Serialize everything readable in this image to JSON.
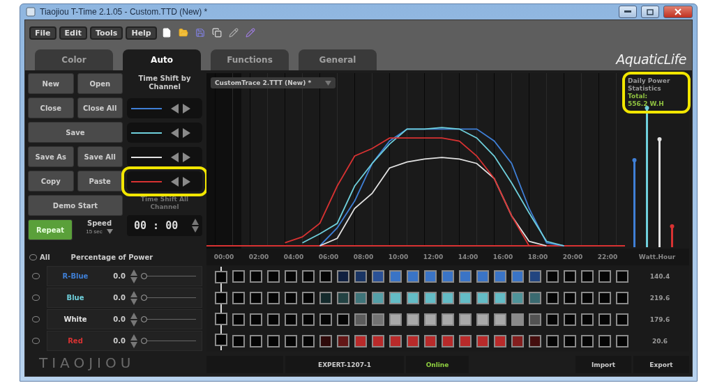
{
  "window": {
    "title": "Tiaojiou T-Time 2.1.05 - Custom.TTD (New) *"
  },
  "menu": [
    "File",
    "Edit",
    "Tools",
    "Help"
  ],
  "tabs": [
    {
      "label": "Color",
      "selected": false
    },
    {
      "label": "Auto",
      "selected": true
    },
    {
      "label": "Functions",
      "selected": false
    },
    {
      "label": "General",
      "selected": false
    }
  ],
  "logo": {
    "text": "AquaticLife"
  },
  "file_buttons": [
    [
      "New",
      "Open"
    ],
    [
      "Close",
      "Close All"
    ],
    [
      "Save"
    ],
    [
      "Save As",
      "Save All"
    ],
    [
      "Copy",
      "Paste"
    ],
    [
      "Demo Start"
    ]
  ],
  "repeat": {
    "label": "Repeat",
    "on": true
  },
  "speed": {
    "label": "Speed",
    "value": "15 sec"
  },
  "time_shift": {
    "title": "Time Shift by Channel",
    "rows": [
      {
        "highlighted": false
      },
      {
        "highlighted": false
      },
      {
        "highlighted": false
      },
      {
        "highlighted": true
      }
    ],
    "all_label": "Time Shift All Channel",
    "all_disabled": true,
    "time": "00 : 00"
  },
  "power": {
    "all_label": "All",
    "all_selected": false,
    "title": "Percentage of Power"
  },
  "channels": [
    {
      "name": "R-Blue",
      "color": "#3f7fd6",
      "selected": false,
      "percent": "0.0",
      "level": 0,
      "watt_hours": "140.4",
      "cells": [
        {
          "color": "#050505"
        },
        {
          "color": "#050505"
        },
        {
          "color": "#050505"
        },
        {
          "color": "#050505"
        },
        {
          "color": "#050505"
        },
        {
          "color": "#050505"
        },
        {
          "color": "#050505"
        },
        {
          "color": "#102040"
        },
        {
          "color": "#1a3564"
        },
        {
          "color": "#2a5196"
        },
        {
          "color": "#3a74c6"
        },
        {
          "color": "#3a74c6"
        },
        {
          "color": "#3a74c6"
        },
        {
          "color": "#3a74c6"
        },
        {
          "color": "#3a74c6"
        },
        {
          "color": "#3a74c6"
        },
        {
          "color": "#3a74c6"
        },
        {
          "color": "#3a74c6"
        },
        {
          "color": "#224580"
        },
        {
          "color": "#050505"
        },
        {
          "color": "#050505"
        },
        {
          "color": "#050505"
        },
        {
          "color": "#050505"
        },
        {
          "color": "#050505"
        }
      ]
    },
    {
      "name": "Blue",
      "color": "#6fd0dc",
      "selected": false,
      "percent": "0.0",
      "level": 0,
      "watt_hours": "219.6",
      "cells": [
        {
          "color": "#050505"
        },
        {
          "color": "#050505"
        },
        {
          "color": "#050505"
        },
        {
          "color": "#050505"
        },
        {
          "color": "#050505"
        },
        {
          "color": "#050505"
        },
        {
          "color": "#142a2c"
        },
        {
          "color": "#234243"
        },
        {
          "color": "#3f7479"
        },
        {
          "color": "#55a0a8"
        },
        {
          "color": "#64bcc6"
        },
        {
          "color": "#64bcc6"
        },
        {
          "color": "#64bcc6"
        },
        {
          "color": "#64bcc6"
        },
        {
          "color": "#64bcc6"
        },
        {
          "color": "#64bcc6"
        },
        {
          "color": "#64bcc6"
        },
        {
          "color": "#4f949a"
        },
        {
          "color": "#3a6a70"
        },
        {
          "color": "#050505"
        },
        {
          "color": "#050505"
        },
        {
          "color": "#050505"
        },
        {
          "color": "#050505"
        },
        {
          "color": "#050505"
        }
      ]
    },
    {
      "name": "White",
      "color": "#e2e2e2",
      "selected": false,
      "percent": "0.0",
      "level": 0,
      "watt_hours": "179.6",
      "cells": [
        {
          "color": "#050505"
        },
        {
          "color": "#050505"
        },
        {
          "color": "#050505"
        },
        {
          "color": "#050505"
        },
        {
          "color": "#050505"
        },
        {
          "color": "#050505"
        },
        {
          "color": "#050505"
        },
        {
          "color": "#050505"
        },
        {
          "color": "#5c5c5c"
        },
        {
          "color": "#737373"
        },
        {
          "color": "#a9a9a9"
        },
        {
          "color": "#a9a9a9"
        },
        {
          "color": "#a9a9a9"
        },
        {
          "color": "#a9a9a9"
        },
        {
          "color": "#a9a9a9"
        },
        {
          "color": "#a9a9a9"
        },
        {
          "color": "#a9a9a9"
        },
        {
          "color": "#8a8a8a"
        },
        {
          "color": "#525252"
        },
        {
          "color": "#050505"
        },
        {
          "color": "#050505"
        },
        {
          "color": "#050505"
        },
        {
          "color": "#050505"
        },
        {
          "color": "#050505"
        }
      ]
    },
    {
      "name": "Red",
      "color": "#d83232",
      "selected": false,
      "percent": "0.0",
      "level": 0,
      "watt_hours": "20.6",
      "cells": [
        {
          "color": "#050505"
        },
        {
          "color": "#050505"
        },
        {
          "color": "#050505"
        },
        {
          "color": "#050505"
        },
        {
          "color": "#050505"
        },
        {
          "color": "#050505"
        },
        {
          "color": "#2e0a0a"
        },
        {
          "color": "#631616"
        },
        {
          "color": "#b82a2a"
        },
        {
          "color": "#b82a2a"
        },
        {
          "color": "#b82a2a"
        },
        {
          "color": "#b82a2a"
        },
        {
          "color": "#b82a2a"
        },
        {
          "color": "#b82a2a"
        },
        {
          "color": "#b82a2a"
        },
        {
          "color": "#b82a2a"
        },
        {
          "color": "#b82a2a"
        },
        {
          "color": "#841e1e"
        },
        {
          "color": "#440e0e"
        },
        {
          "color": "#050505"
        },
        {
          "color": "#050505"
        },
        {
          "color": "#050505"
        },
        {
          "color": "#050505"
        },
        {
          "color": "#050505"
        }
      ]
    }
  ],
  "chart": {
    "file": "CustomTrace 2.TTT (New) *",
    "hours": [
      "00:00",
      "02:00",
      "04:00",
      "06:00",
      "08:00",
      "10:00",
      "12:00",
      "14:00",
      "16:00",
      "18:00",
      "20:00",
      "22:00"
    ],
    "unit": "Watt.Hour",
    "stats": {
      "title": "Daily Power Statistics",
      "total_label": "Total:",
      "total": "556.2 W.H",
      "highlighted": true
    }
  },
  "brand": "TIAOJIOU",
  "status": {
    "device": "EXPERT-1207-1",
    "connection": "Online",
    "buttons": [
      "Import",
      "Export"
    ]
  }
}
